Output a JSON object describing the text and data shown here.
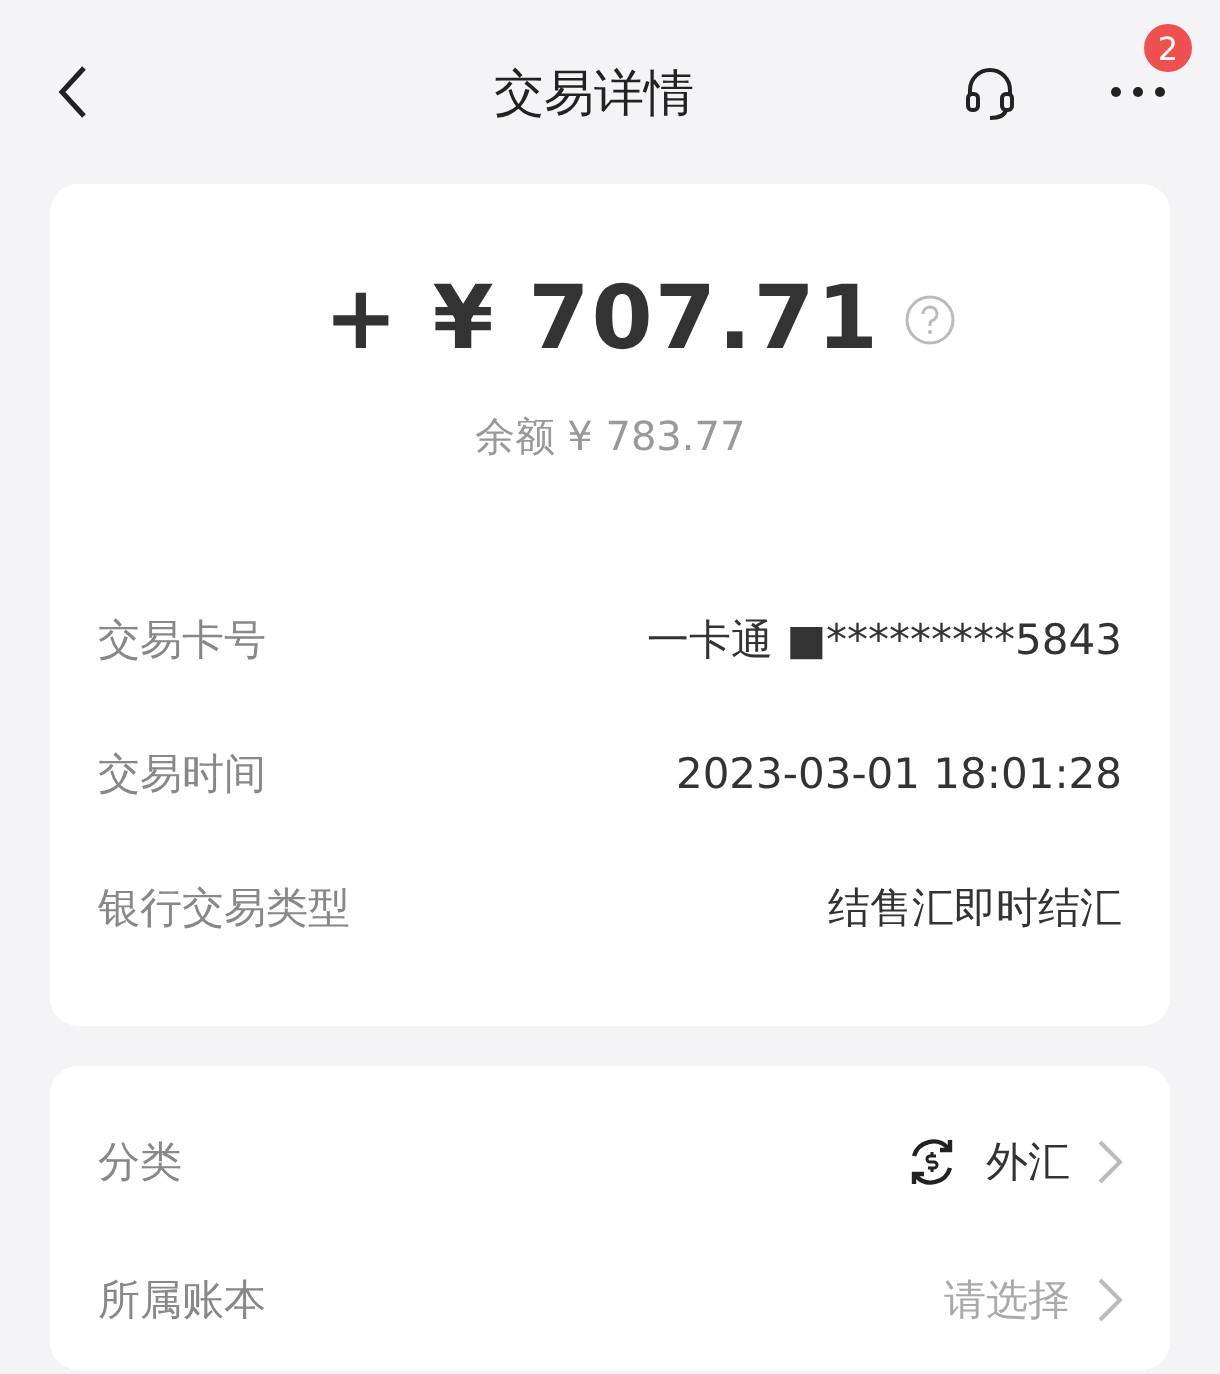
{
  "header": {
    "title": "交易详情",
    "badge": "2"
  },
  "amount": {
    "sign": "+",
    "currency": "¥",
    "value": "707.71",
    "balance": "余额 ¥ 783.77"
  },
  "details": [
    {
      "label": "交易卡号",
      "value": "一卡通 ■*********5843"
    },
    {
      "label": "交易时间",
      "value": "2023-03-01 18:01:28"
    },
    {
      "label": "银行交易类型",
      "value": "结售汇即时结汇"
    }
  ],
  "settings": [
    {
      "label": "分类",
      "value": "外汇",
      "kind": "category"
    },
    {
      "label": "所属账本",
      "value": "请选择",
      "kind": "placeholder"
    }
  ]
}
